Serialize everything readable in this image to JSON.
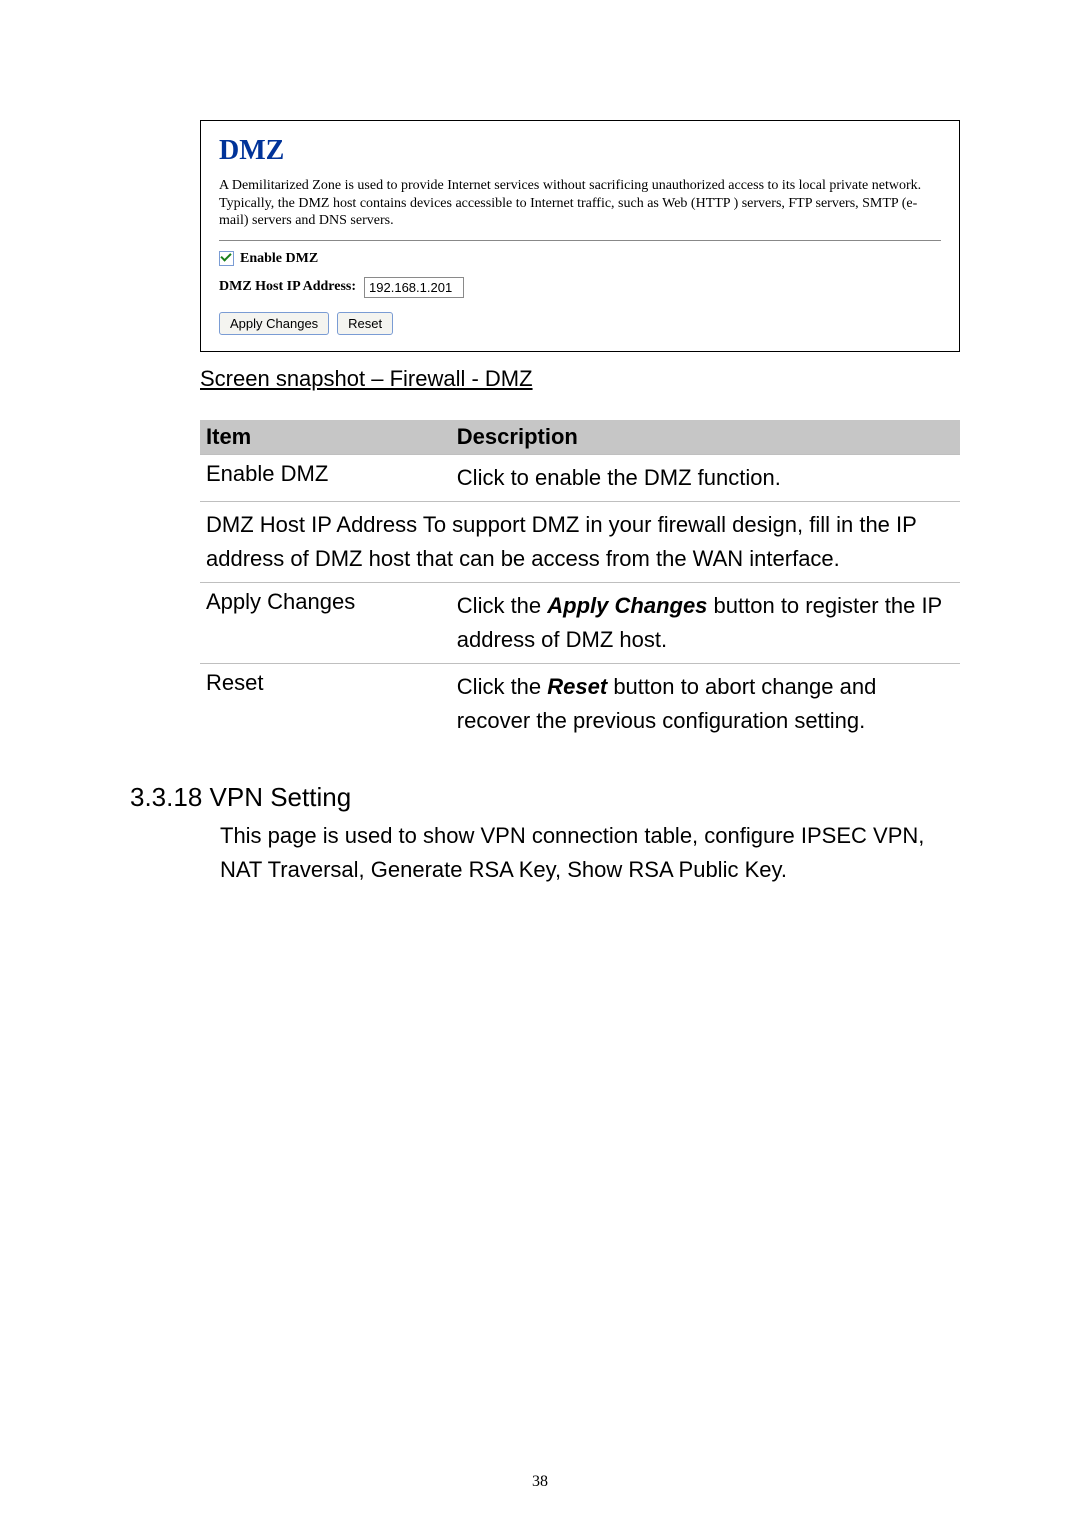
{
  "panel": {
    "title": "DMZ",
    "description": "A Demilitarized Zone is used to provide Internet services without sacrificing unauthorized access to its local private network. Typically, the DMZ host contains devices accessible to Internet traffic, such as Web (HTTP ) servers, FTP servers, SMTP (e-mail) servers and DNS servers.",
    "enable_label": "Enable DMZ",
    "enable_checked": true,
    "addr_label": "DMZ Host IP Address:",
    "addr_value": "192.168.1.201",
    "apply_btn": "Apply Changes",
    "reset_btn": "Reset"
  },
  "caption": "Screen snapshot – Firewall - DMZ",
  "table": {
    "headers": {
      "item": "Item",
      "desc": "Description"
    },
    "rows": [
      {
        "item": "Enable DMZ",
        "desc": "Click to enable the DMZ function."
      },
      {
        "item": "DMZ Host IP Address",
        "desc_pre": "To support DMZ in your firewall design, fill in the IP address of DMZ host that can be access from the WAN interface."
      },
      {
        "item": "Apply Changes",
        "desc_pre": "Click the ",
        "desc_bold": "Apply Changes",
        "desc_post": " button to register the IP address of DMZ host."
      },
      {
        "item": "Reset",
        "desc_pre": "Click the ",
        "desc_bold": "Reset",
        "desc_post": " button to abort change and recover the previous configuration setting."
      }
    ]
  },
  "section": {
    "num": "3.3.18",
    "title": "VPN Setting",
    "body": "This page is used to show VPN connection table, configure IPSEC VPN, NAT Traversal, Generate RSA Key, Show RSA Public Key."
  },
  "page_number": "38"
}
